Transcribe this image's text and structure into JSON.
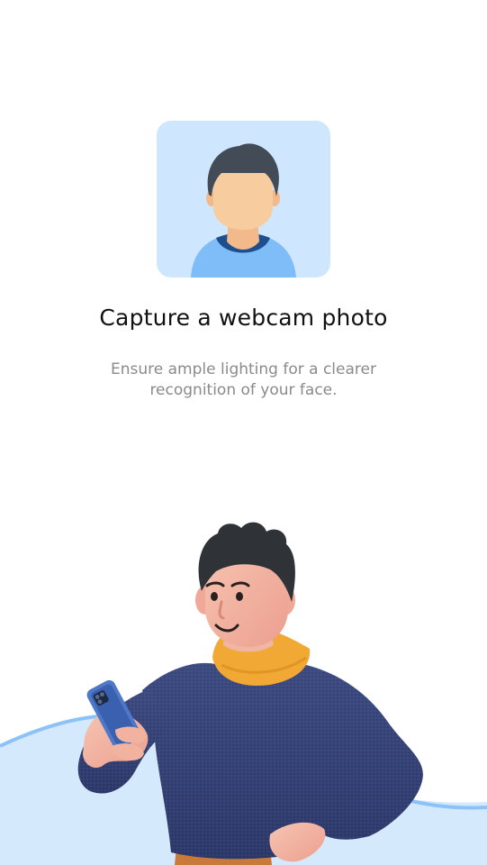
{
  "onboarding": {
    "title": "Capture a webcam photo",
    "subtitle": "Ensure ample lighting for a clearer recognition of your face.",
    "illustration_icon": "person-holding-phone-illustration",
    "avatar_icon": "user-avatar-icon"
  },
  "colors": {
    "background": "#ffffff",
    "avatar_card": "#cfe7fe",
    "accent_blue": "#7fbdf8",
    "title_text": "#111111",
    "subtitle_text": "#8a8a8a"
  }
}
